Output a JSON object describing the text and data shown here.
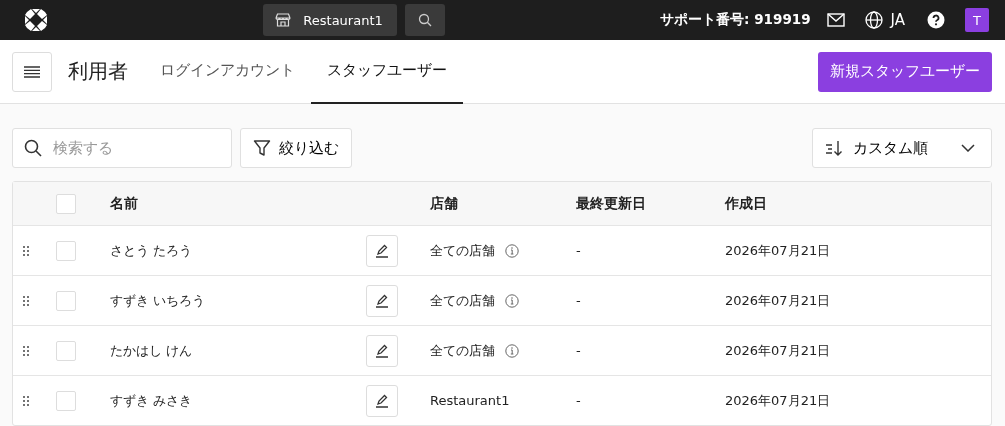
{
  "topbar": {
    "store": "Restaurant1",
    "support": "サポート番号: 919919",
    "language": "JA",
    "avatar": "T"
  },
  "header": {
    "title": "利用者",
    "tabs": [
      {
        "label": "ログインアカウント",
        "selected": false
      },
      {
        "label": "スタッフユーザー",
        "selected": true
      }
    ],
    "new_button": "新規スタッフユーザー"
  },
  "toolbar": {
    "search": {
      "placeholder": "検索する"
    },
    "filter": "絞り込む",
    "sort": "カスタム順"
  },
  "table": {
    "header_checked": false,
    "columns": [
      "名前",
      "店舗",
      "最終更新日",
      "作成日"
    ],
    "rows": [
      {
        "checked": false,
        "name": "さとう たろう",
        "store": "全ての店舗",
        "info": true,
        "updated": "-",
        "created": "2026年07月21日"
      },
      {
        "checked": false,
        "name": "すずき いちろう",
        "store": "全ての店舗",
        "info": true,
        "updated": "-",
        "created": "2026年07月21日"
      },
      {
        "checked": false,
        "name": "たかはし けん",
        "store": "全ての店舗",
        "info": true,
        "updated": "-",
        "created": "2026年07月21日"
      },
      {
        "checked": false,
        "name": "すずき みさき",
        "store": "Restaurant1",
        "info": false,
        "updated": "-",
        "created": "2026年07月21日"
      }
    ]
  }
}
